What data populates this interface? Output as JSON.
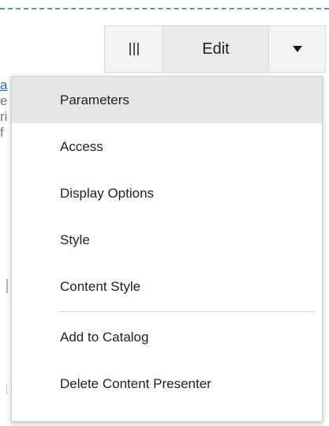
{
  "toolbar": {
    "handle_icon": "drag-handle-icon",
    "edit_label": "Edit",
    "dropdown_icon": "caret-down-icon"
  },
  "background_text": {
    "line1": "a",
    "line2": "e",
    "line3": "ri",
    "line4": "f"
  },
  "menu": {
    "items": [
      {
        "label": "Parameters"
      },
      {
        "label": "Access"
      },
      {
        "label": "Display Options"
      },
      {
        "label": "Style"
      },
      {
        "label": "Content Style"
      },
      {
        "label": "Add to Catalog"
      },
      {
        "label": "Delete Content Presenter"
      }
    ],
    "highlight_color": "#e6e6e6"
  }
}
